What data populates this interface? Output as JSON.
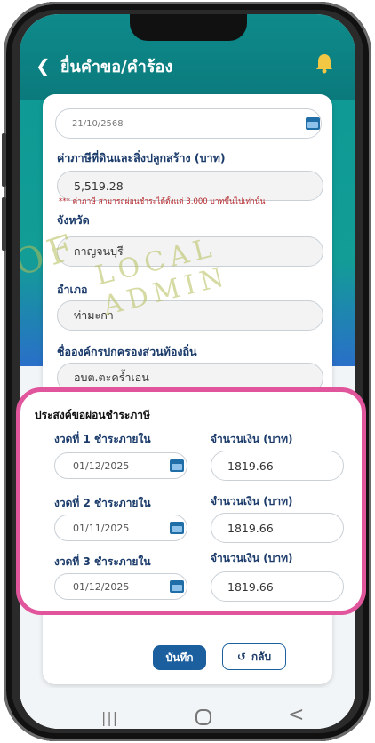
{
  "header": {
    "title": "ยื่นคำขอ/คำร้อง"
  },
  "form": {
    "date_value": "21/10/2568",
    "tax_label": "ค่าภาษีที่ดินและสิ่งปลูกสร้าง (บาท)",
    "tax_value": "5,519.28",
    "installment_note": "*** ค่าภาษี สามารถผ่อนชำระได้ตั้งแต่ 3,000 บาทขึ้นไปเท่านั้น",
    "province_label": "จังหวัด",
    "province_value": "กาญจนบุรี",
    "district_label": "อำเภอ",
    "district_value": "ท่ามะกา",
    "org_label": "ชื่อองค์กรปกครองส่วนท้องถิ่น",
    "org_value": "อบต.ตะคร้ำเอน"
  },
  "installments": {
    "title": "ประสงค์ขอผ่อนชำระภาษี",
    "amount_label": "จำนวนเงิน (บาท)",
    "rows": [
      {
        "label": "งวดที่ 1 ชำระภายใน",
        "date": "01/12/2025",
        "amount": "1819.66"
      },
      {
        "label": "งวดที่ 2 ชำระภายใน",
        "date": "01/11/2025",
        "amount": "1819.66"
      },
      {
        "label": "งวดที่ 3 ชำระภายใน",
        "date": "01/12/2025",
        "amount": "1819.66"
      }
    ]
  },
  "buttons": {
    "save": "บันทึก",
    "back": "กลับ",
    "back_glyph": "↺"
  },
  "watermark": {
    "left_text": "OF",
    "right_text": "LOCAL   ADMIN"
  },
  "nav": {
    "recent_glyph": "|||",
    "back_glyph": "<"
  },
  "colors": {
    "header": "#0e8a8a",
    "highlight": "#e0559b",
    "save_button": "#1c5f9e",
    "label": "#1a3a6a",
    "note": "#b5262b"
  }
}
